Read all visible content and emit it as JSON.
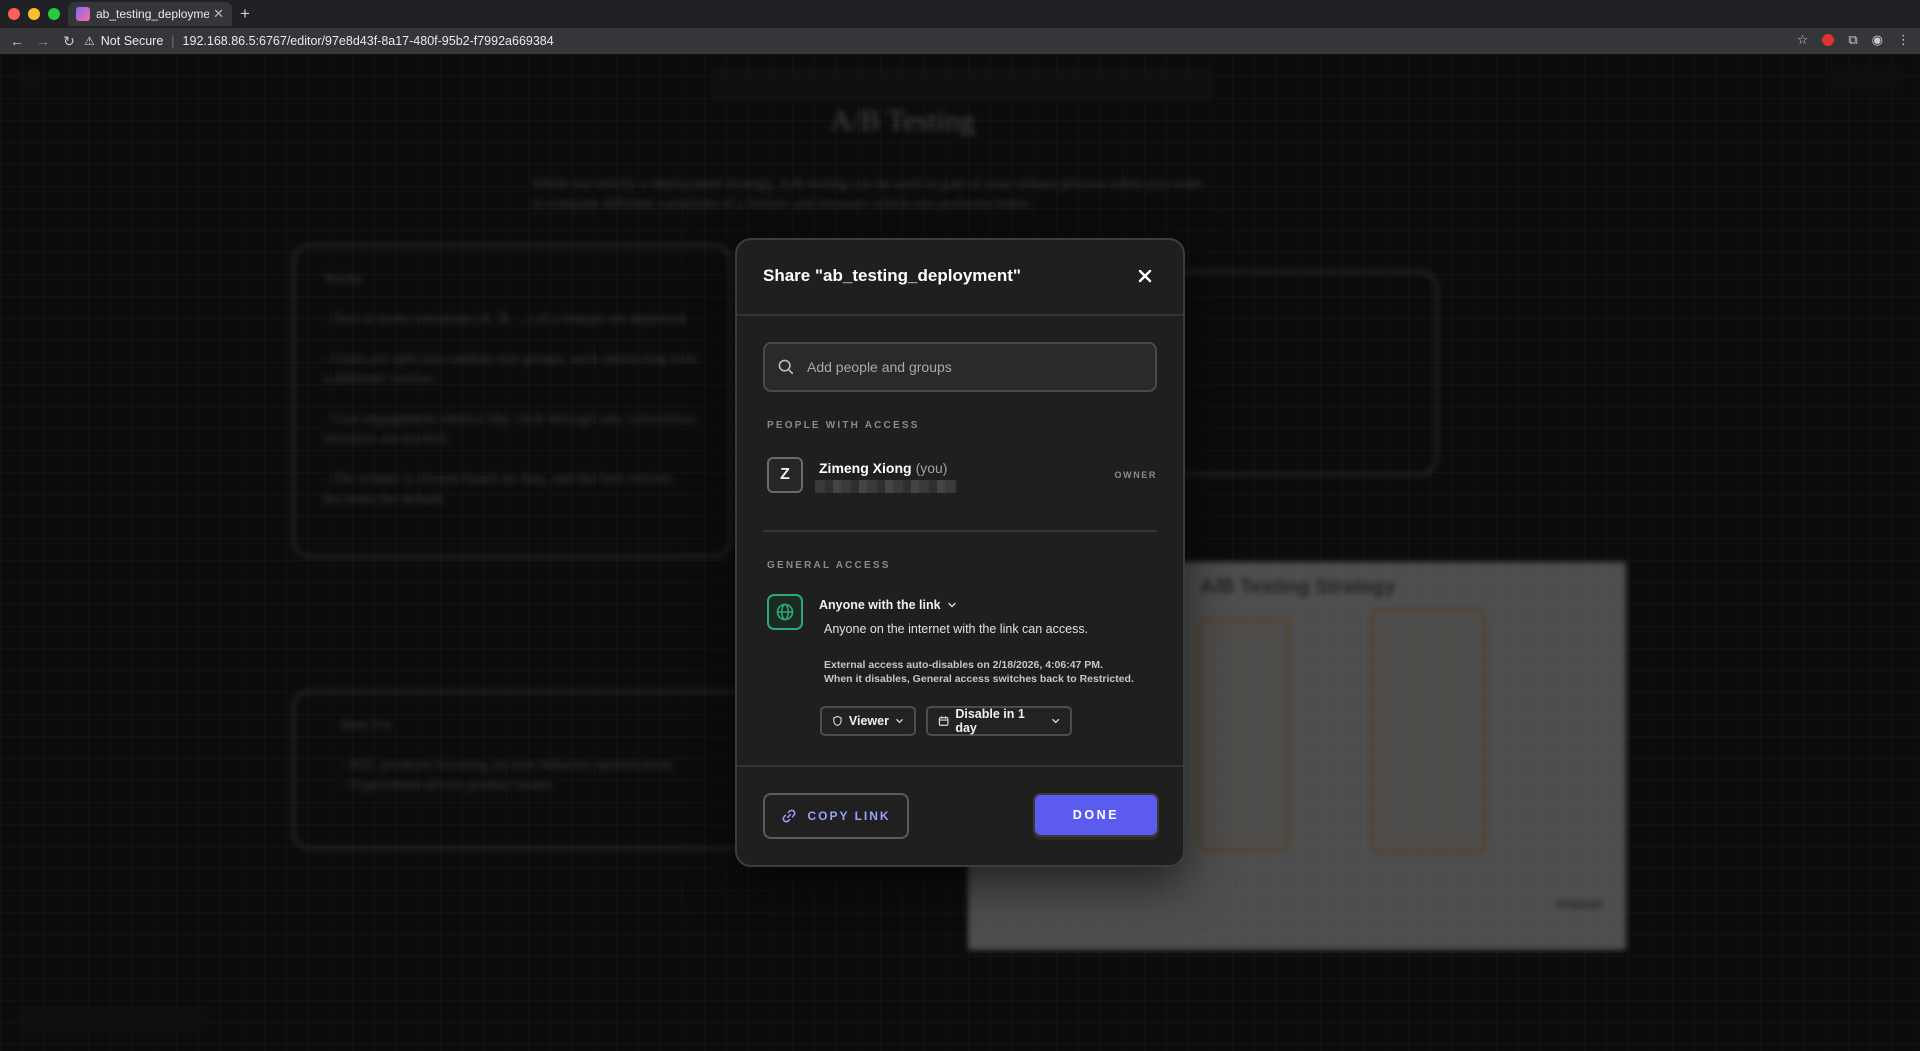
{
  "browser": {
    "tab_title": "ab_testing_deployment",
    "security_label": "Not Secure",
    "url": "192.168.86.5:6767/editor/97e8d43f-8a17-480f-95b2-f7992a669384"
  },
  "background": {
    "doc_title": "A/B Testing",
    "description": "While not strictly a deployment strategy, A/B testing can be used as part of your release process when you want to compare different variations of a feature and measure which one performs better.",
    "works_card": {
      "heading": "Works",
      "items": [
        "- Two or more variations (A, B, ...) of a feature are deployed.",
        "- Users are split into random test groups, each interacting with a different version.",
        "- User engagement metrics like click-through rate, conversion, retention are tracked.",
        "- The winner is chosen based on data, and the best version becomes the default."
      ]
    },
    "best_for_card": {
      "heading": "Best For",
      "items": [
        "- B2C products focusing on user behavior optimization.",
        "- Experiment-driven product teams."
      ]
    },
    "image_title": "A/B Testing Strategy",
    "image_logo": "eraser"
  },
  "modal": {
    "title": "Share \"ab_testing_deployment\"",
    "search_placeholder": "Add people and groups",
    "people_label": "PEOPLE WITH ACCESS",
    "person": {
      "initial": "Z",
      "name": "Zimeng Xiong",
      "you_tag": "(you)",
      "role": "OWNER"
    },
    "general_label": "GENERAL ACCESS",
    "access_mode": "Anyone with the link",
    "access_description": "Anyone on the internet with the link can access.",
    "access_note_line1": "External access auto-disables on 2/18/2026, 4:06:47 PM.",
    "access_note_line2": "When it disables, General access switches back to Restricted.",
    "permission": "Viewer",
    "expiry": "Disable in 1 day",
    "copy_link_label": "COPY LINK",
    "done_label": "DONE"
  },
  "colors": {
    "accent": "#5b5bf0",
    "link_text": "#9aa0ff",
    "globe_green": "#2ea879"
  }
}
